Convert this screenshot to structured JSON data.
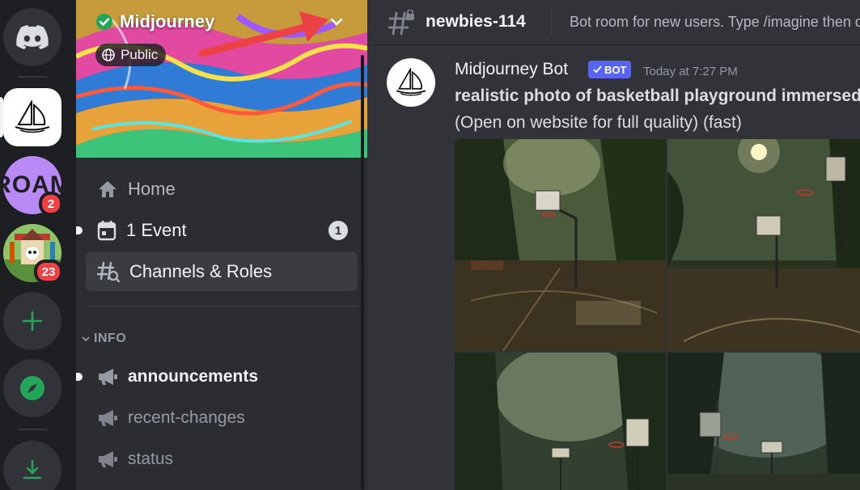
{
  "rail": {
    "home_icon": "discord-logo-icon",
    "servers": [
      {
        "name": "midjourney-server",
        "icon": "sailboat-icon"
      },
      {
        "name": "roam-server",
        "text": "ROAM",
        "badge": "2"
      },
      {
        "name": "game-server",
        "badge": "23"
      }
    ],
    "add_icon": "plus-icon",
    "explore_icon": "compass-icon",
    "download_icon": "download-icon",
    "colors": {
      "add": "#23a55a",
      "badge": "#f23f43"
    }
  },
  "server": {
    "name": "Midjourney",
    "visibility": "Public",
    "verified_icon": "verified-check-icon",
    "dropdown_icon": "chevron-down-icon"
  },
  "nav": {
    "home": "Home",
    "event": "1 Event",
    "event_count": "1",
    "channels_roles": "Channels & Roles"
  },
  "category": {
    "name": "INFO"
  },
  "channels": [
    {
      "name": "announcements",
      "unread": true
    },
    {
      "name": "recent-changes",
      "unread": false
    },
    {
      "name": "status",
      "unread": false
    }
  ],
  "header": {
    "channel": "newbies-114",
    "topic": "Bot room for new users. Type /imagine then describe what you want to draw."
  },
  "message": {
    "author": "Midjourney Bot",
    "bot_tag": "BOT",
    "timestamp": "Today at 7:27 PM",
    "prompt": "realistic photo of basketball playground immersed in a tropical rainforest",
    "note": "(Open on website for full quality) (fast)"
  },
  "colors": {
    "accent": "#5865f2",
    "arrow": "#ed4245",
    "verified": "#23a55a"
  }
}
